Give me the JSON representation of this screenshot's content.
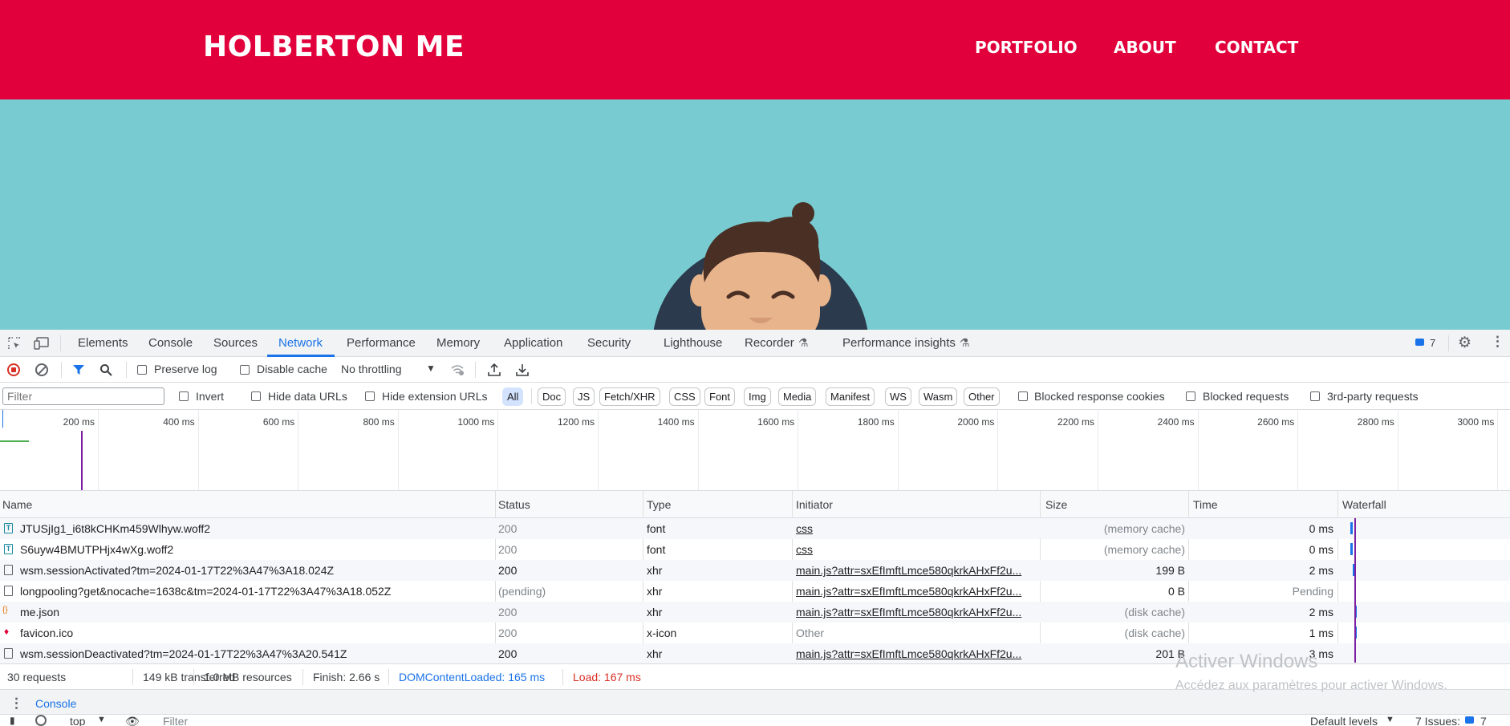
{
  "site": {
    "brand": "HOLBERTON ME",
    "nav": [
      "PORTFOLIO",
      "ABOUT",
      "CONTACT"
    ]
  },
  "devtools": {
    "tabs": [
      "Elements",
      "Console",
      "Sources",
      "Network",
      "Performance",
      "Memory",
      "Application",
      "Security",
      "Lighthouse",
      "Recorder",
      "Performance insights"
    ],
    "active_tab": "Network",
    "issues_count": "7",
    "toolbar": {
      "preserve_log": "Preserve log",
      "disable_cache": "Disable cache",
      "throttling": "No throttling"
    },
    "filter": {
      "placeholder": "Filter",
      "invert": "Invert",
      "hide_data_urls": "Hide data URLs",
      "hide_extension_urls": "Hide extension URLs",
      "types": [
        "All",
        "Doc",
        "JS",
        "Fetch/XHR",
        "CSS",
        "Font",
        "Img",
        "Media",
        "Manifest",
        "WS",
        "Wasm",
        "Other"
      ],
      "selected_type": "All",
      "blocked_response_cookies": "Blocked response cookies",
      "blocked_requests": "Blocked requests",
      "third_party": "3rd-party requests"
    },
    "overview_ticks": [
      "200 ms",
      "400 ms",
      "600 ms",
      "800 ms",
      "1000 ms",
      "1200 ms",
      "1400 ms",
      "1600 ms",
      "1800 ms",
      "2000 ms",
      "2200 ms",
      "2400 ms",
      "2600 ms",
      "2800 ms",
      "3000 ms"
    ],
    "columns": [
      "Name",
      "Status",
      "Type",
      "Initiator",
      "Size",
      "Time",
      "Waterfall"
    ],
    "rows": [
      {
        "name": "JTUSjIg1_i6t8kCHKm459Wlhyw.woff2",
        "status": "200",
        "type": "font",
        "initiator": "css",
        "size": "(memory cache)",
        "time": "0 ms",
        "icon": "font-file-icon"
      },
      {
        "name": "S6uyw4BMUTPHjx4wXg.woff2",
        "status": "200",
        "type": "font",
        "initiator": "css",
        "size": "(memory cache)",
        "time": "0 ms",
        "icon": "font-file-icon"
      },
      {
        "name": "wsm.sessionActivated?tm=2024-01-17T22%3A47%3A18.024Z",
        "status": "200",
        "type": "xhr",
        "initiator": "main.js?attr=sxEfImftLmce580qkrkAHxFf2u...",
        "size": "199 B",
        "time": "2 ms",
        "icon": "document-icon"
      },
      {
        "name": "longpooling?get&nocache=1638c&tm=2024-01-17T22%3A47%3A18.052Z",
        "status": "(pending)",
        "type": "xhr",
        "initiator": "main.js?attr=sxEfImftLmce580qkrkAHxFf2u...",
        "size": "0 B",
        "time": "Pending",
        "icon": "document-icon"
      },
      {
        "name": "me.json",
        "status": "200",
        "type": "xhr",
        "initiator": "main.js?attr=sxEfImftLmce580qkrkAHxFf2u...",
        "size": "(disk cache)",
        "time": "2 ms",
        "icon": "json-icon"
      },
      {
        "name": "favicon.ico",
        "status": "200",
        "type": "x-icon",
        "initiator": "Other",
        "size": "(disk cache)",
        "time": "1 ms",
        "icon": "favicon-icon"
      },
      {
        "name": "wsm.sessionDeactivated?tm=2024-01-17T22%3A47%3A20.541Z",
        "status": "200",
        "type": "xhr",
        "initiator": "main.js?attr=sxEfImftLmce580qkrkAHxFf2u...",
        "size": "201 B",
        "time": "3 ms",
        "icon": "document-icon"
      }
    ],
    "status_bar": {
      "requests": "30 requests",
      "transferred": "149 kB transferred",
      "resources": "1.0 MB resources",
      "finish": "Finish: 2.66 s",
      "dom_content_loaded": "DOMContentLoaded: 165 ms",
      "load": "Load: 167 ms"
    },
    "drawer": {
      "console_tab": "Console",
      "context": "top",
      "filter_placeholder": "Filter",
      "levels": "Default levels",
      "issues": "7 Issues:",
      "issues_count": "7"
    },
    "colors": {
      "accent": "#1a73e8",
      "header": "#e1003b",
      "hero": "#78ccd1",
      "load": "#d93025"
    }
  },
  "watermark": {
    "title": "Activer Windows",
    "subtitle": "Accédez aux paramètres pour activer Windows."
  }
}
